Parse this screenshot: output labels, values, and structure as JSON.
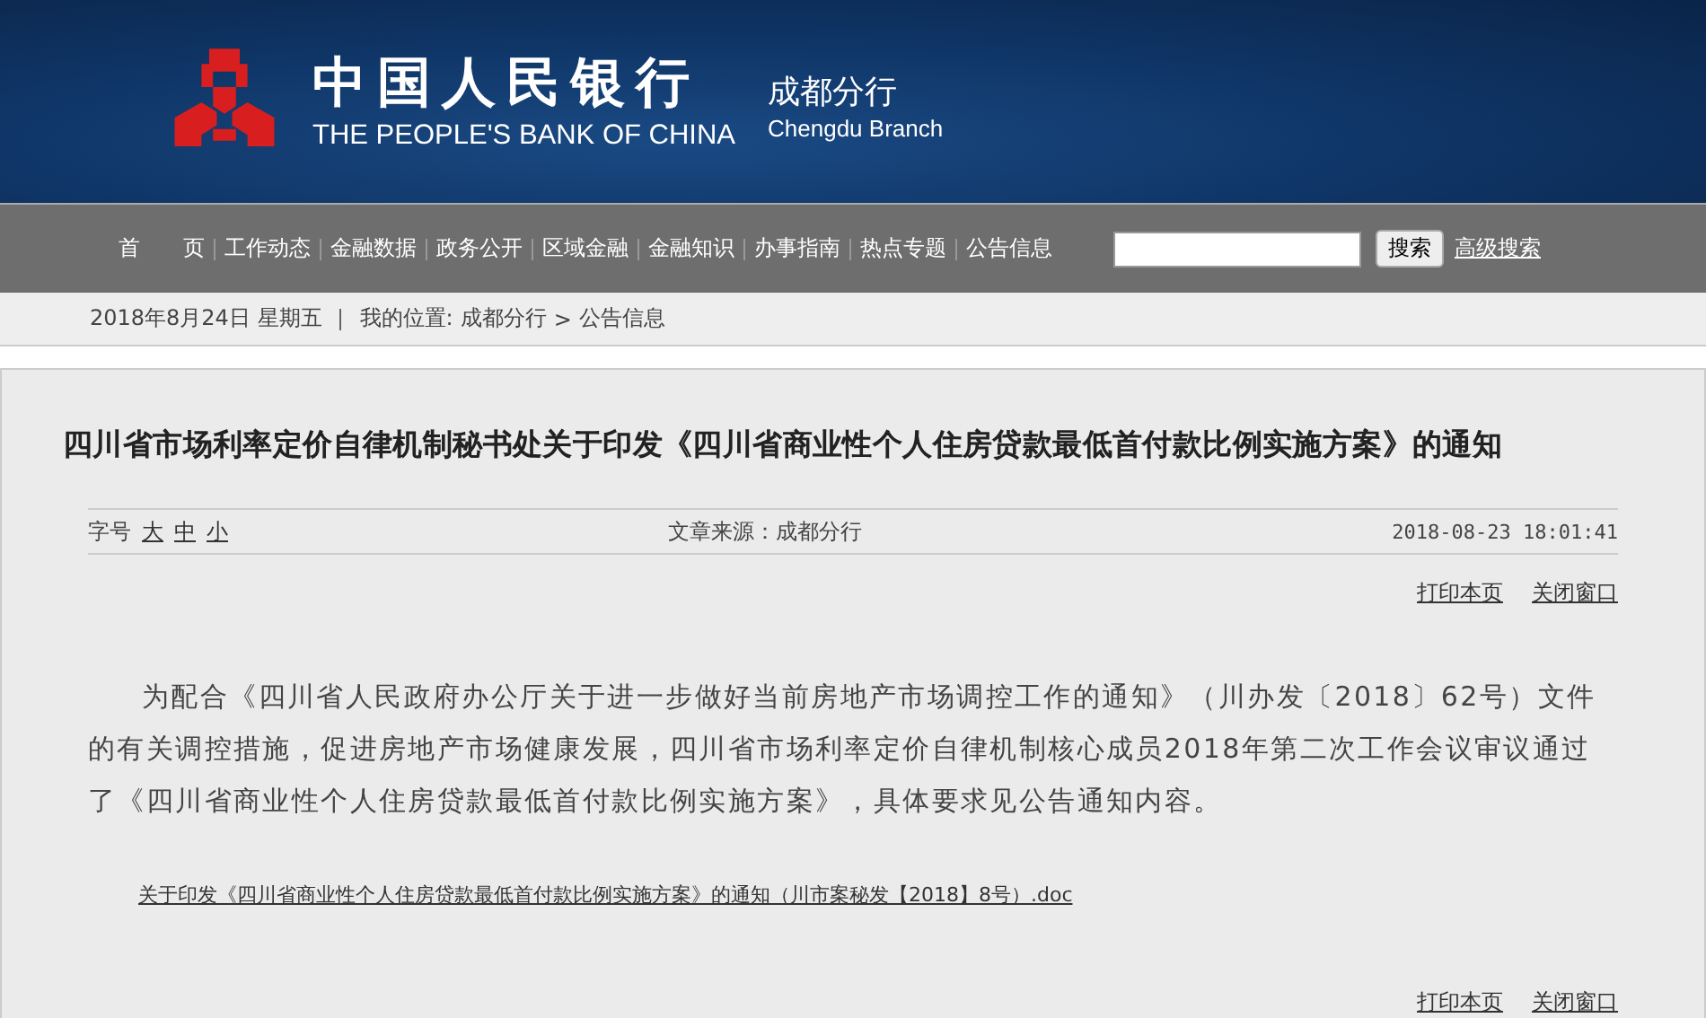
{
  "header": {
    "bank_name_cn": "中国人民银行",
    "bank_name_en": "THE PEOPLE'S BANK OF CHINA",
    "branch_cn": "成都分行",
    "branch_en": "Chengdu  Branch"
  },
  "nav": {
    "items": [
      "首　　页",
      "工作动态",
      "金融数据",
      "政务公开",
      "区域金融",
      "金融知识",
      "办事指南",
      "热点专题",
      "公告信息"
    ],
    "search_button": "搜索",
    "advanced_search": "高级搜索"
  },
  "breadcrumb": {
    "date": "2018年8月24日  星期五",
    "location_label": "我的位置:",
    "path": [
      "成都分行",
      "公告信息"
    ],
    "separator": ">"
  },
  "article": {
    "title": "四川省市场利率定价自律机制秘书处关于印发《四川省商业性个人住房贷款最低首付款比例实施方案》的通知",
    "font_size_label": "字号",
    "font_sizes": [
      "大",
      "中",
      "小"
    ],
    "source": "文章来源：成都分行",
    "timestamp": "2018-08-23 18:01:41",
    "actions": [
      "打印本页",
      "关闭窗口"
    ],
    "body": "为配合《四川省人民政府办公厅关于进一步做好当前房地产市场调控工作的通知》（川办发〔2018〕62号）文件的有关调控措施，促进房地产市场健康发展，四川省市场利率定价自律机制核心成员2018年第二次工作会议审议通过了《四川省商业性个人住房贷款最低首付款比例实施方案》，具体要求见公告通知内容。",
    "attachment": "关于印发《四川省商业性个人住房贷款最低首付款比例实施方案》的通知（川市案秘发【2018】8号）.doc",
    "bottom_actions": [
      "打印本页",
      "关闭窗口"
    ]
  }
}
